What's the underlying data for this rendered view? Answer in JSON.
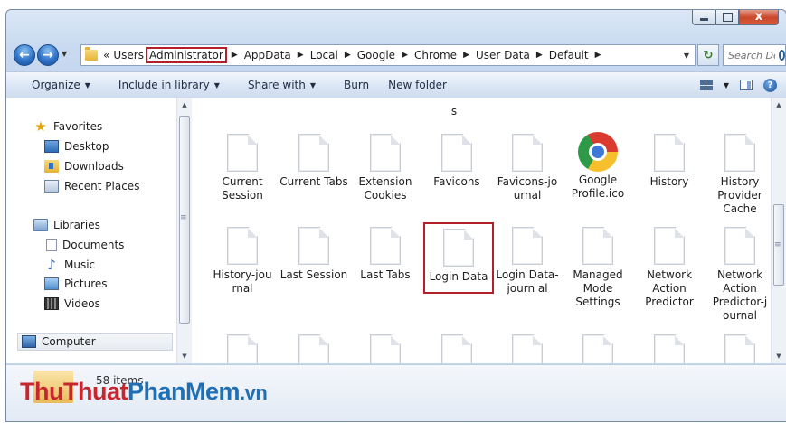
{
  "window": {
    "caption_close": "x"
  },
  "address": {
    "breadcrumb": [
      "Users",
      "Administrator",
      "AppData",
      "Local",
      "Google",
      "Chrome",
      "User Data",
      "Default"
    ],
    "highlighted_index": 1,
    "overflow_marker": "«",
    "search_placeholder": "Search Def..."
  },
  "toolbar": {
    "organize": "Organize",
    "include_in_library": "Include in library",
    "share_with": "Share with",
    "burn": "Burn",
    "new_folder": "New folder"
  },
  "nav_pane": {
    "favorites": "Favorites",
    "desktop": "Desktop",
    "downloads": "Downloads",
    "recent_places": "Recent Places",
    "libraries": "Libraries",
    "documents": "Documents",
    "music": "Music",
    "pictures": "Pictures",
    "videos": "Videos",
    "computer": "Computer"
  },
  "files": {
    "cut_top": [
      "s"
    ],
    "row1": [
      "Current Session",
      "Current Tabs",
      "Extension Cookies",
      "Favicons",
      "Favicons-jo urnal",
      "Google Profile.ico",
      "History",
      "History Provider Cache"
    ],
    "row2": [
      "History-jou rnal",
      "Last Session",
      "Last Tabs",
      "Login Data",
      "Login Data-journ al",
      "Managed Mode Settings",
      "Network Action Predictor",
      "Network Action Predictor-j ournal"
    ],
    "highlighted": "Login Data"
  },
  "status": {
    "item_count": "58 items"
  },
  "watermark": {
    "part1": "ThuThuat",
    "part2": "PhanMem",
    "part3": ".vn"
  },
  "icons": {
    "back": "back-arrow-icon",
    "forward": "forward-arrow-icon",
    "chrome": "chrome-logo-icon"
  }
}
